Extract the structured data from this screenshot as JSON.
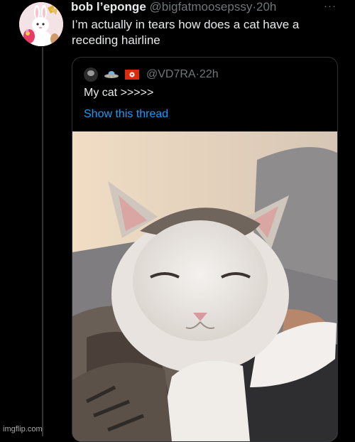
{
  "tweet": {
    "display_name": "bob l’eponge",
    "handle": "@bigfatmoosepssy",
    "separator": "·",
    "time": "20h",
    "more_label": "···",
    "text": "I’m actually in tears how does a cat have a receding hairline",
    "avatar_icon": "bunny-toy-icon"
  },
  "quoted_tweet": {
    "handle": "@VD7RA",
    "separator": "·",
    "time": "22h",
    "text": "My cat >>>>>",
    "show_thread_label": "Show this thread",
    "emoji_icons": [
      "ufo-icon",
      "hong-kong-flag-icon"
    ]
  },
  "colors": {
    "background": "#000000",
    "text": "#e7e9ea",
    "muted": "#71767b",
    "link": "#1d9bf0",
    "border": "#2f3336"
  },
  "watermark": "imgflip.com"
}
